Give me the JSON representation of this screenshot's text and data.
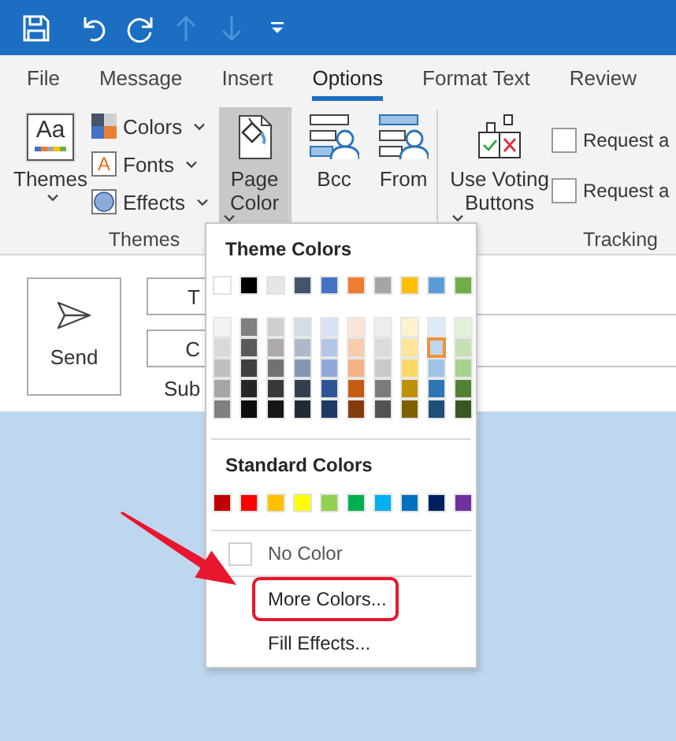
{
  "tabs": [
    {
      "label": "File",
      "selected": false
    },
    {
      "label": "Message",
      "selected": false
    },
    {
      "label": "Insert",
      "selected": false
    },
    {
      "label": "Options",
      "selected": true
    },
    {
      "label": "Format Text",
      "selected": false
    },
    {
      "label": "Review",
      "selected": false
    }
  ],
  "ribbon": {
    "themes_group": {
      "label": "Themes",
      "button": {
        "label": "Themes",
        "icon_text": "Aa"
      },
      "items": [
        {
          "kind": "colors",
          "label": "Colors"
        },
        {
          "kind": "fonts",
          "label": "Fonts",
          "glyph": "A"
        },
        {
          "kind": "effects",
          "label": "Effects"
        }
      ],
      "page_color_button": {
        "label": "Page Color",
        "selected": true
      }
    },
    "show_fields": [
      {
        "kind": "bcc",
        "label": "Bcc"
      },
      {
        "kind": "from",
        "label": "From"
      }
    ],
    "tracking_group": {
      "label": "Tracking",
      "voting_button": {
        "label": "Use Voting Buttons"
      },
      "options": [
        {
          "label": "Request a",
          "checked": false
        },
        {
          "label": "Request a",
          "checked": false
        }
      ]
    }
  },
  "compose": {
    "send_button": "Send",
    "fields": [
      {
        "label": "T"
      },
      {
        "label": "C"
      }
    ],
    "subject_label": "Sub"
  },
  "menu": {
    "theme_colors": {
      "heading": "Theme Colors",
      "columns": [
        {
          "base": {
            "color": "#ffffff",
            "selected": false
          },
          "shades": [
            {
              "color": "#f2f2f2",
              "selected": false
            },
            {
              "color": "#d9d9d9",
              "selected": false
            },
            {
              "color": "#bfbfbf",
              "selected": false
            },
            {
              "color": "#a6a6a6",
              "selected": false
            },
            {
              "color": "#808080",
              "selected": false
            }
          ]
        },
        {
          "base": {
            "color": "#000000",
            "selected": false
          },
          "shades": [
            {
              "color": "#808080",
              "selected": false
            },
            {
              "color": "#595959",
              "selected": false
            },
            {
              "color": "#404040",
              "selected": false
            },
            {
              "color": "#262626",
              "selected": false
            },
            {
              "color": "#0d0d0d",
              "selected": false
            }
          ]
        },
        {
          "base": {
            "color": "#e7e6e6",
            "selected": false
          },
          "shades": [
            {
              "color": "#d0cece",
              "selected": false
            },
            {
              "color": "#aeaaaa",
              "selected": false
            },
            {
              "color": "#757171",
              "selected": false
            },
            {
              "color": "#3a3838",
              "selected": false
            },
            {
              "color": "#171616",
              "selected": false
            }
          ]
        },
        {
          "base": {
            "color": "#44546a",
            "selected": false
          },
          "shades": [
            {
              "color": "#d6dce4",
              "selected": false
            },
            {
              "color": "#adb9ca",
              "selected": false
            },
            {
              "color": "#8497b0",
              "selected": false
            },
            {
              "color": "#333f4f",
              "selected": false
            },
            {
              "color": "#222a35",
              "selected": false
            }
          ]
        },
        {
          "base": {
            "color": "#4472c4",
            "selected": false
          },
          "shades": [
            {
              "color": "#d9e2f3",
              "selected": false
            },
            {
              "color": "#b4c6e7",
              "selected": false
            },
            {
              "color": "#8eaadb",
              "selected": false
            },
            {
              "color": "#2f5496",
              "selected": false
            },
            {
              "color": "#1f3864",
              "selected": false
            }
          ]
        },
        {
          "base": {
            "color": "#ed7d31",
            "selected": false
          },
          "shades": [
            {
              "color": "#fbe5d6",
              "selected": false
            },
            {
              "color": "#f8cbad",
              "selected": false
            },
            {
              "color": "#f4b183",
              "selected": false
            },
            {
              "color": "#c55a11",
              "selected": false
            },
            {
              "color": "#843c0c",
              "selected": false
            }
          ]
        },
        {
          "base": {
            "color": "#a5a5a5",
            "selected": false
          },
          "shades": [
            {
              "color": "#ededed",
              "selected": false
            },
            {
              "color": "#dbdbdb",
              "selected": false
            },
            {
              "color": "#c9c9c9",
              "selected": false
            },
            {
              "color": "#7b7b7b",
              "selected": false
            },
            {
              "color": "#525252",
              "selected": false
            }
          ]
        },
        {
          "base": {
            "color": "#ffc000",
            "selected": false
          },
          "shades": [
            {
              "color": "#fff2cc",
              "selected": false
            },
            {
              "color": "#ffe699",
              "selected": false
            },
            {
              "color": "#ffd966",
              "selected": false
            },
            {
              "color": "#bf9000",
              "selected": false
            },
            {
              "color": "#7f6000",
              "selected": false
            }
          ]
        },
        {
          "base": {
            "color": "#5b9bd5",
            "selected": false
          },
          "shades": [
            {
              "color": "#deebf7",
              "selected": false
            },
            {
              "color": "#bdd7ee",
              "selected": true
            },
            {
              "color": "#9dc3e6",
              "selected": false
            },
            {
              "color": "#2e75b6",
              "selected": false
            },
            {
              "color": "#1f4e79",
              "selected": false
            }
          ]
        },
        {
          "base": {
            "color": "#70ad47",
            "selected": false
          },
          "shades": [
            {
              "color": "#e2f0d9",
              "selected": false
            },
            {
              "color": "#c5e0b4",
              "selected": false
            },
            {
              "color": "#a9d18e",
              "selected": false
            },
            {
              "color": "#548235",
              "selected": false
            },
            {
              "color": "#385723",
              "selected": false
            }
          ]
        }
      ]
    },
    "standard_colors": {
      "heading": "Standard Colors",
      "swatches": [
        {
          "color": "#c00000",
          "selected": false
        },
        {
          "color": "#ff0000",
          "selected": false
        },
        {
          "color": "#ffc000",
          "selected": false
        },
        {
          "color": "#ffff00",
          "selected": false
        },
        {
          "color": "#92d050",
          "selected": false
        },
        {
          "color": "#00b050",
          "selected": false
        },
        {
          "color": "#00b0f0",
          "selected": false
        },
        {
          "color": "#0070c0",
          "selected": false
        },
        {
          "color": "#002060",
          "selected": false
        },
        {
          "color": "#7030a0",
          "selected": false
        }
      ]
    },
    "items": [
      {
        "kind": "no-color",
        "label": "No Color",
        "highlighted": false
      },
      {
        "kind": "command",
        "label": "More Colors...",
        "highlighted": true
      },
      {
        "kind": "command",
        "label": "Fill Effects...",
        "highlighted": false
      }
    ]
  }
}
